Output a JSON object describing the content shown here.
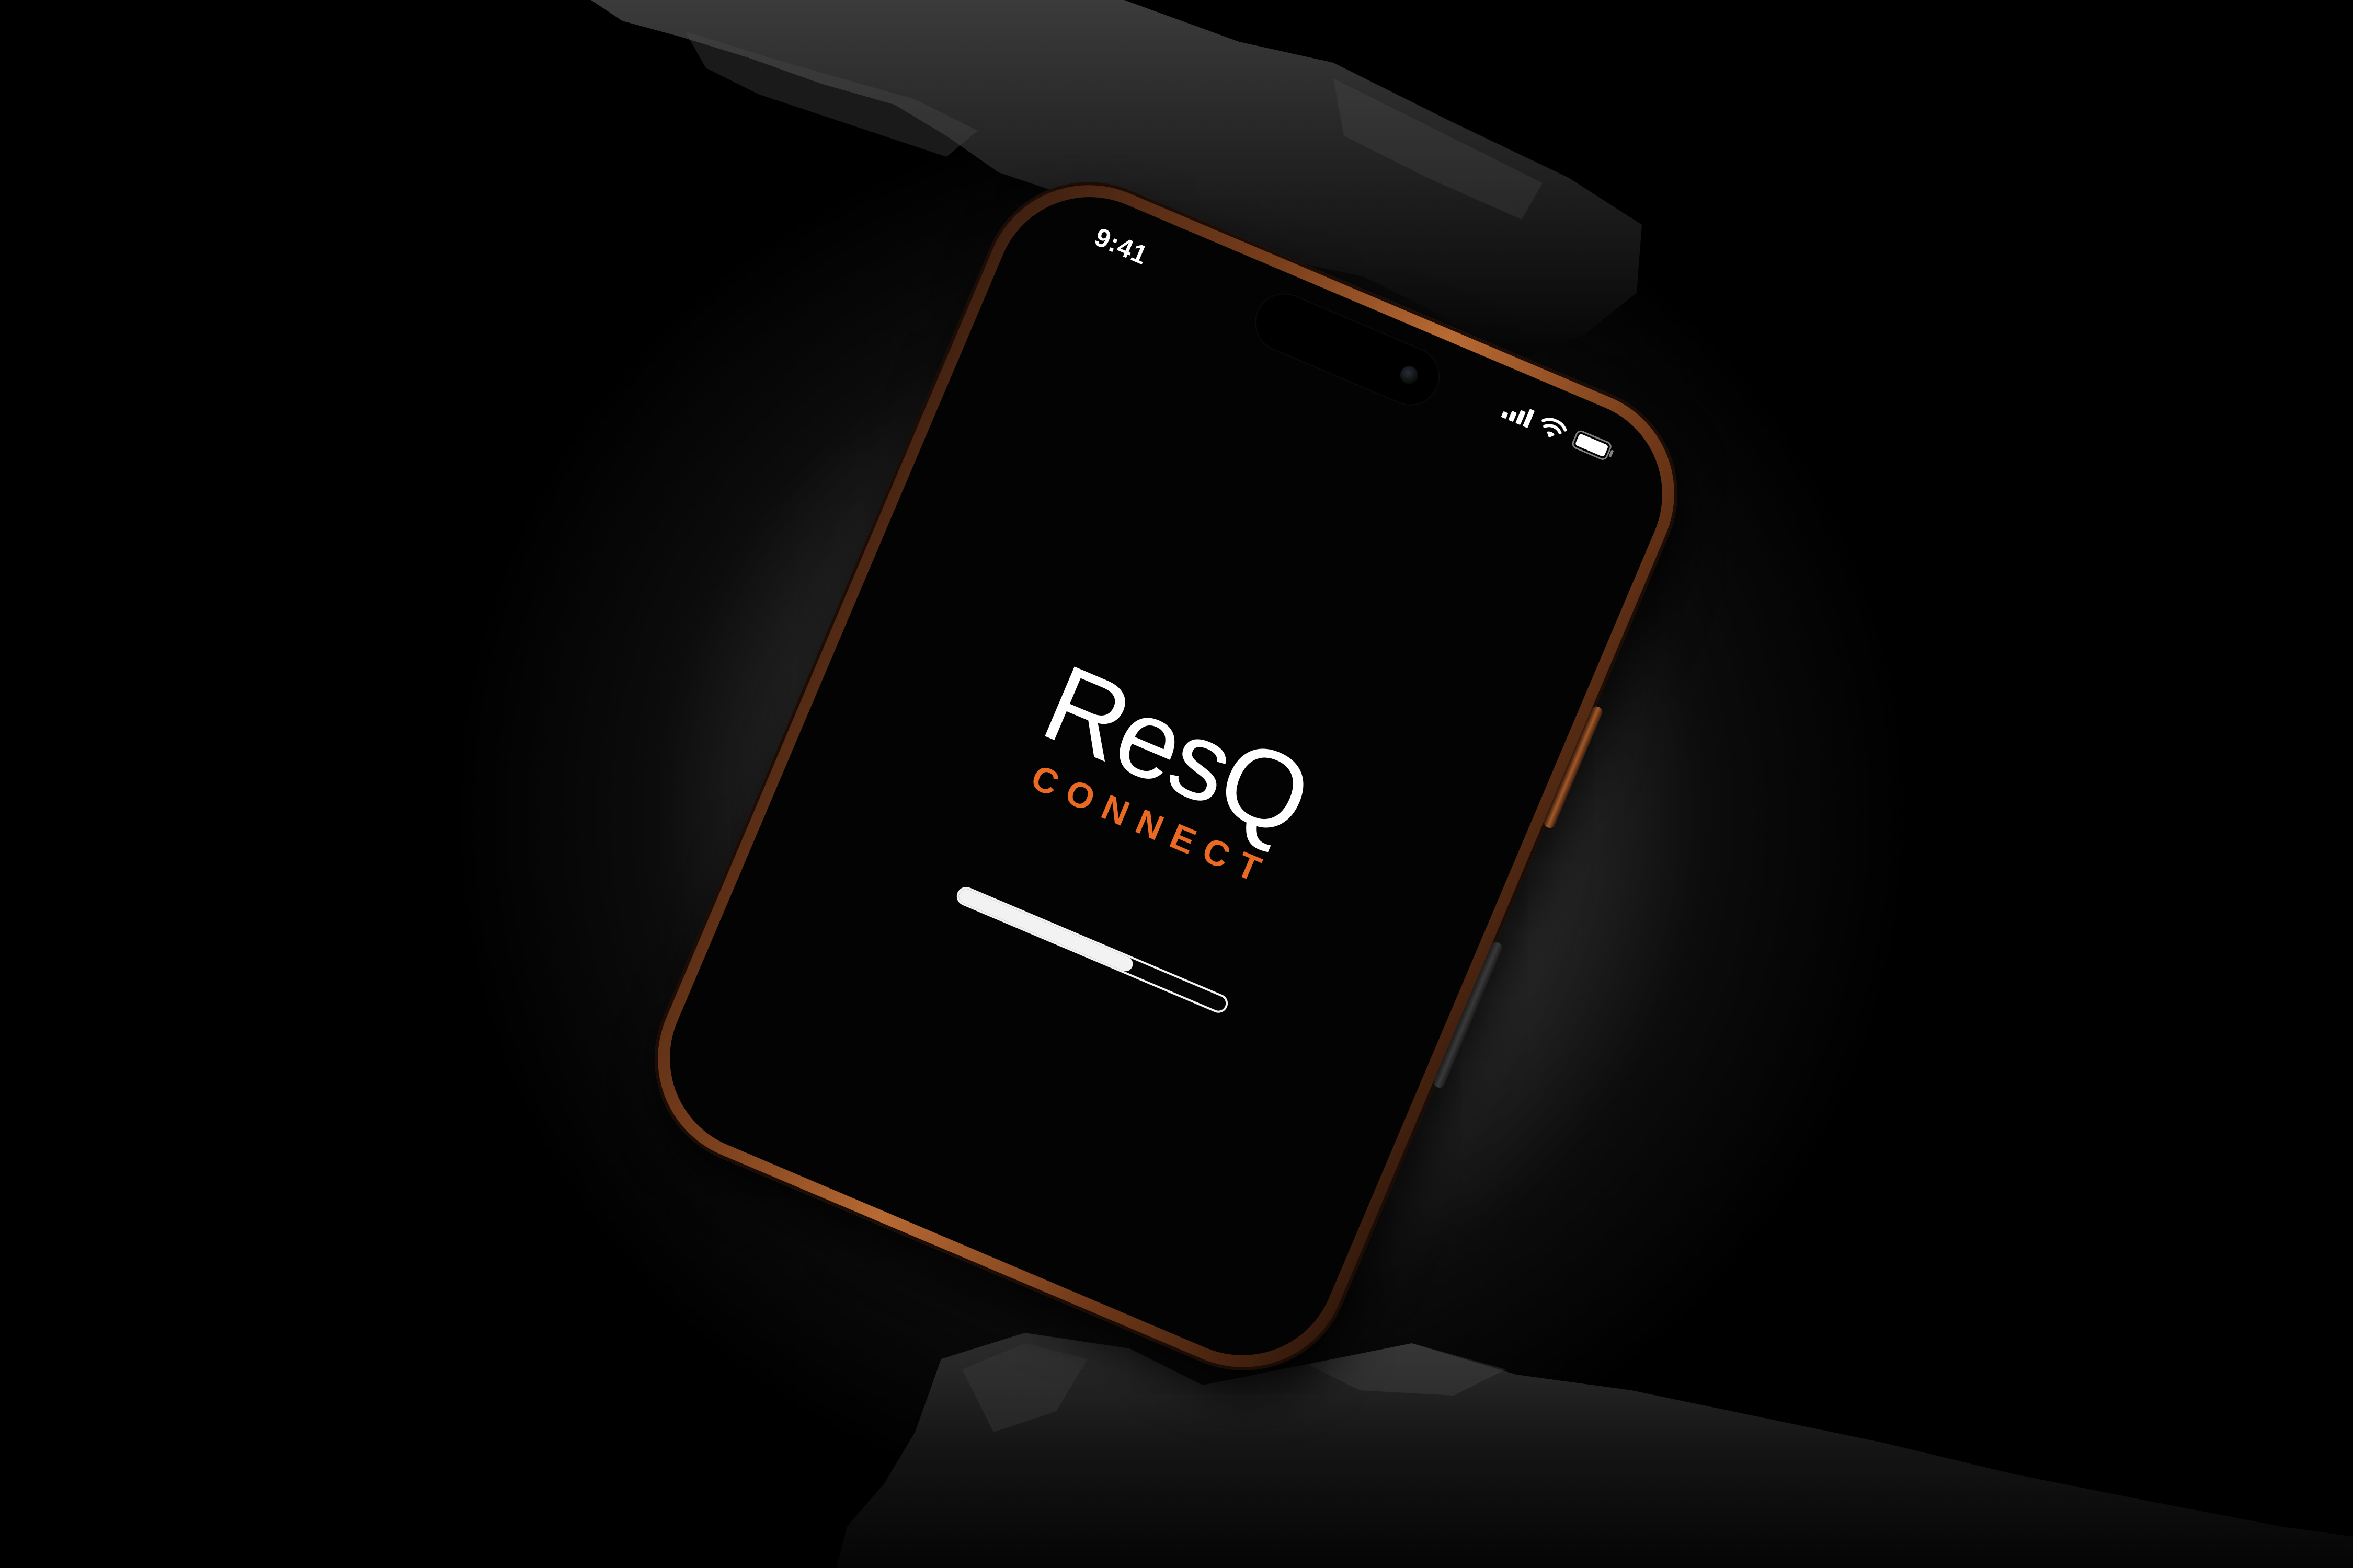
{
  "status_bar": {
    "time": "9:41",
    "signal_icon": "cellular-signal-icon",
    "wifi_icon": "wifi-icon",
    "battery_icon": "battery-icon"
  },
  "splash": {
    "logo_primary": "ResQ",
    "logo_secondary": "CONNECT",
    "loading_progress": 0.65
  },
  "colors": {
    "brand_orange": "#ea6a24",
    "screen_background": "#030303",
    "text_primary": "#ffffff",
    "phone_frame": "#7a3f1c"
  }
}
